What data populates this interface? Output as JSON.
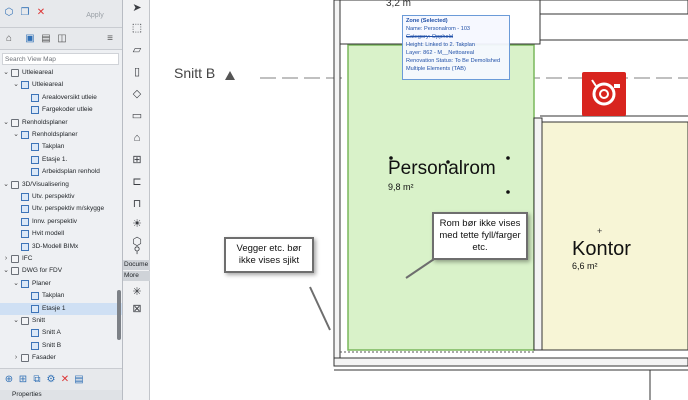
{
  "navigator": {
    "apply_label": "Apply",
    "search_placeholder": "Search View Map",
    "tree": [
      {
        "label": "Utleieareal",
        "type": "folder",
        "level": 1
      },
      {
        "label": "Utleieareal",
        "type": "view",
        "level": 2
      },
      {
        "label": "Arealoversikt utleie",
        "type": "table",
        "level": 3
      },
      {
        "label": "Fargekoder utleie",
        "type": "table",
        "level": 3
      },
      {
        "label": "Renholdsplaner",
        "type": "folder",
        "level": 1
      },
      {
        "label": "Renholdsplaner",
        "type": "view",
        "level": 2
      },
      {
        "label": "Takplan",
        "type": "plan",
        "level": 3
      },
      {
        "label": "Etasje 1.",
        "type": "plan",
        "level": 3
      },
      {
        "label": "Arbeidsplan renhold",
        "type": "table",
        "level": 3
      },
      {
        "label": "3D/Visualisering",
        "type": "folder",
        "level": 1
      },
      {
        "label": "Utv. perspektiv",
        "type": "view3d",
        "level": 2
      },
      {
        "label": "Utv. perspektiv m/skygge",
        "type": "view3d",
        "level": 2
      },
      {
        "label": "Innv. perspektiv",
        "type": "view3d",
        "level": 2
      },
      {
        "label": "Hvit modell",
        "type": "view3d",
        "level": 2
      },
      {
        "label": "3D-Modell BIMx",
        "type": "view3d",
        "level": 2
      },
      {
        "label": "IFC",
        "type": "folder",
        "level": 1
      },
      {
        "label": "DWG for FDV",
        "type": "folder",
        "level": 1
      },
      {
        "label": "Planer",
        "type": "view",
        "level": 2
      },
      {
        "label": "Takplan",
        "type": "plan",
        "level": 3
      },
      {
        "label": "Etasje 1",
        "type": "plan",
        "level": 3,
        "selected": true
      },
      {
        "label": "Snitt",
        "type": "folder",
        "level": 2
      },
      {
        "label": "Snitt A",
        "type": "plan",
        "level": 3
      },
      {
        "label": "Snitt B",
        "type": "plan",
        "level": 3
      },
      {
        "label": "Fasader",
        "type": "folder",
        "level": 2
      }
    ],
    "properties_label": "Properties"
  },
  "toolbox": {
    "document_label": "Docume",
    "more_label": "More"
  },
  "canvas": {
    "top_number": "3,2 m",
    "section_label": "Snitt B",
    "info_box": {
      "lines": [
        "Zone (Selected)",
        "Name: Personalrom - 103",
        "Category: Opphold",
        "Height: Linked to 2. Takplan",
        "Layer: 862 - M__Nettoareal",
        "Renovation Status: To Be Demolished",
        "Multiple Elements (TAB)"
      ]
    },
    "rooms": {
      "personalrom": {
        "name": "Personalrom",
        "area": "9,8 m²"
      },
      "kontor": {
        "name": "Kontor",
        "area": "6,6 m²"
      }
    },
    "callouts": {
      "walls": "Vegger etc. bør ikke vises sjikt",
      "room": "Rom bør ikke vises med tette fyll/farger etc."
    },
    "colors": {
      "zone_fill": "#d9f2c9",
      "zone_stroke": "#7ab85c",
      "kontor_fill": "#f7f5d6",
      "fire_red": "#d8241e",
      "selection_blue": "#2050a8"
    }
  }
}
